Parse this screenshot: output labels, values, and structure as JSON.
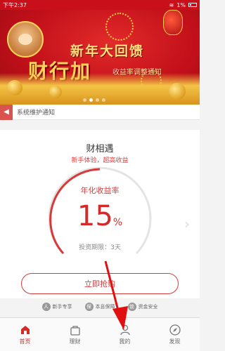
{
  "status_bar": {
    "time": "下午2:37",
    "battery": "1%"
  },
  "banner": {
    "line1": "新年大回馈",
    "line2": "财行加",
    "line3": "收益率调整通知",
    "slide_count": 4,
    "active_slide": 2
  },
  "notice": {
    "text": "系统维护通知"
  },
  "product": {
    "name": "财相遇",
    "subtitle": "新手体验，超高收益",
    "rate_label": "年化收益率",
    "rate_value": "15",
    "rate_unit": "%",
    "term": "投资期限：3天",
    "button_label": "立即抢购"
  },
  "features": [
    {
      "icon": "user-icon",
      "label": "新手专享"
    },
    {
      "icon": "shield-icon",
      "label": "本息保障"
    },
    {
      "icon": "lock-icon",
      "label": "资金安全"
    }
  ],
  "tabs": [
    {
      "label": "首页",
      "icon": "home-icon",
      "active": true
    },
    {
      "label": "理财",
      "icon": "bag-icon",
      "active": false
    },
    {
      "label": "我的",
      "icon": "person-icon",
      "active": false
    },
    {
      "label": "发现",
      "icon": "compass-icon",
      "active": false
    }
  ],
  "colors": {
    "accent": "#d52a2a",
    "banner_red": "#c2101a",
    "gold": "#ffd45a"
  }
}
